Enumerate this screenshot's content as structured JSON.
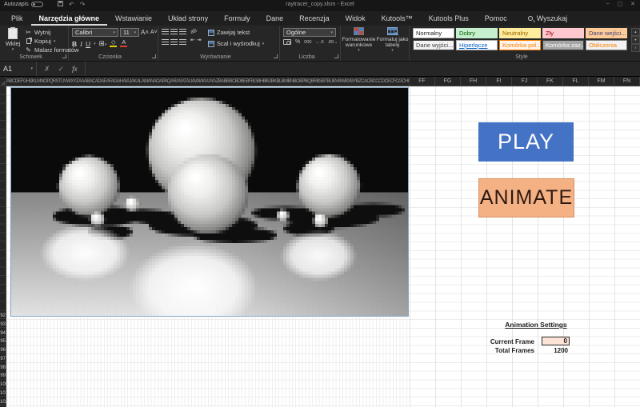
{
  "titlebar": {
    "autosave_label": "Autozapis",
    "filename": "raytracer_copy.xlsm - Excel"
  },
  "tabs": {
    "items": [
      "Plik",
      "Narzędzia główne",
      "Wstawianie",
      "Układ strony",
      "Formuły",
      "Dane",
      "Recenzja",
      "Widok",
      "Kutools™",
      "Kutools Plus",
      "Pomoc"
    ],
    "active": "Narzędzia główne",
    "search_label": "Wyszukaj"
  },
  "ribbon": {
    "clipboard": {
      "paste": "Wklej",
      "cut": "Wytnij",
      "copy": "Kopiuj",
      "format_painter": "Malarz formatów",
      "group_label": "Schowek"
    },
    "font": {
      "name": "Calibri",
      "size": "11",
      "group_label": "Czcionka"
    },
    "alignment": {
      "wrap_text": "Zawijaj tekst",
      "merge_center": "Scal i wyśrodkuj",
      "group_label": "Wyrównanie"
    },
    "number": {
      "format": "Ogólne",
      "group_label": "Liczba"
    },
    "format_buttons": {
      "conditional": "Formatowanie warunkowe",
      "as_table": "Formatuj jako tabelę"
    },
    "styles": {
      "group_label": "Style",
      "chips": [
        {
          "label": "Normalny",
          "bg": "#FFFFFF",
          "fg": "#1a1a1a",
          "border": "#ababab"
        },
        {
          "label": "Dobry",
          "bg": "#C6EFCE",
          "fg": "#006100",
          "border": "#C6EFCE"
        },
        {
          "label": "Neutralny",
          "bg": "#FFEB9C",
          "fg": "#9C6500",
          "border": "#FFEB9C"
        },
        {
          "label": "Zły",
          "bg": "#FFC7CE",
          "fg": "#9C0006",
          "border": "#FFC7CE"
        },
        {
          "label": "Dane wejści...",
          "bg": "#FFCC99",
          "fg": "#3F3F76",
          "border": "#FFCC99"
        },
        {
          "label": "Dane wyjści...",
          "bg": "#F2F2F2",
          "fg": "#3F3F3F",
          "border": "#3F3F3F"
        },
        {
          "label": "Hiperłącze",
          "bg": "#FFFFFF",
          "fg": "#0563C1",
          "border": "#ababab",
          "underline": true
        },
        {
          "label": "Komórka poł...",
          "bg": "#FDF4EC",
          "fg": "#FA7D00",
          "border": "#FA7D00"
        },
        {
          "label": "Komórka zaz...",
          "bg": "#A5A5A5",
          "fg": "#FFFFFF",
          "border": "#3F3F3F"
        },
        {
          "label": "Obliczenia",
          "bg": "#F2F2F2",
          "fg": "#FA7D00",
          "border": "#7F7F7F"
        }
      ]
    }
  },
  "formula_bar": {
    "name_box": "A1",
    "fx_label": "fx"
  },
  "grid": {
    "crammed_column_headers": "ABCDEFGHIJKLMNOPQRSTUVWXYZAAABACADAEAFAGAHAIAJAKALAMANAOAPAQARASATAUAVAWAXAYAZBABBBCBDBEBFBGBHBIBJBKBLBMBNBOBPBQBRBSBTBUBVBWBXBYBZCACBCCCDCECFCGCHCICJCKCLCMCNCOCPCQCRCSCTCUCVCWCXCYCZDADBDCDDDEDFDGDHDIDJDKDLDMDNDODPDQDRDSDTDUDVDWDXDYDZEAEBECEDEEEFEGEHEIEJEKELEMENEOEPEQERESETEUEVEWEXEYEZFAFBFCFDFE",
    "wide_columns": [
      "FF",
      "FG",
      "FH",
      "FI",
      "FJ",
      "FK",
      "FL",
      "FM",
      "FN"
    ],
    "visible_row_numbers": [
      "92",
      "93",
      "94",
      "95",
      "96",
      "97",
      "98",
      "99",
      "100",
      "101",
      "102"
    ]
  },
  "sheet_buttons": {
    "play_label": "PLAY",
    "animate_label": "ANIMATE",
    "play_bg": "#4472C4",
    "play_fg": "#FFFFFF",
    "animate_bg": "#F4B183",
    "animate_fg": "#2E1A12"
  },
  "animation_settings": {
    "title": "Animation Settings",
    "current_frame_label": "Current Frame",
    "current_frame_value": "0",
    "total_frames_label": "Total Frames",
    "total_frames_value": "1200",
    "value_cell_bg": "#FCE4D6"
  }
}
